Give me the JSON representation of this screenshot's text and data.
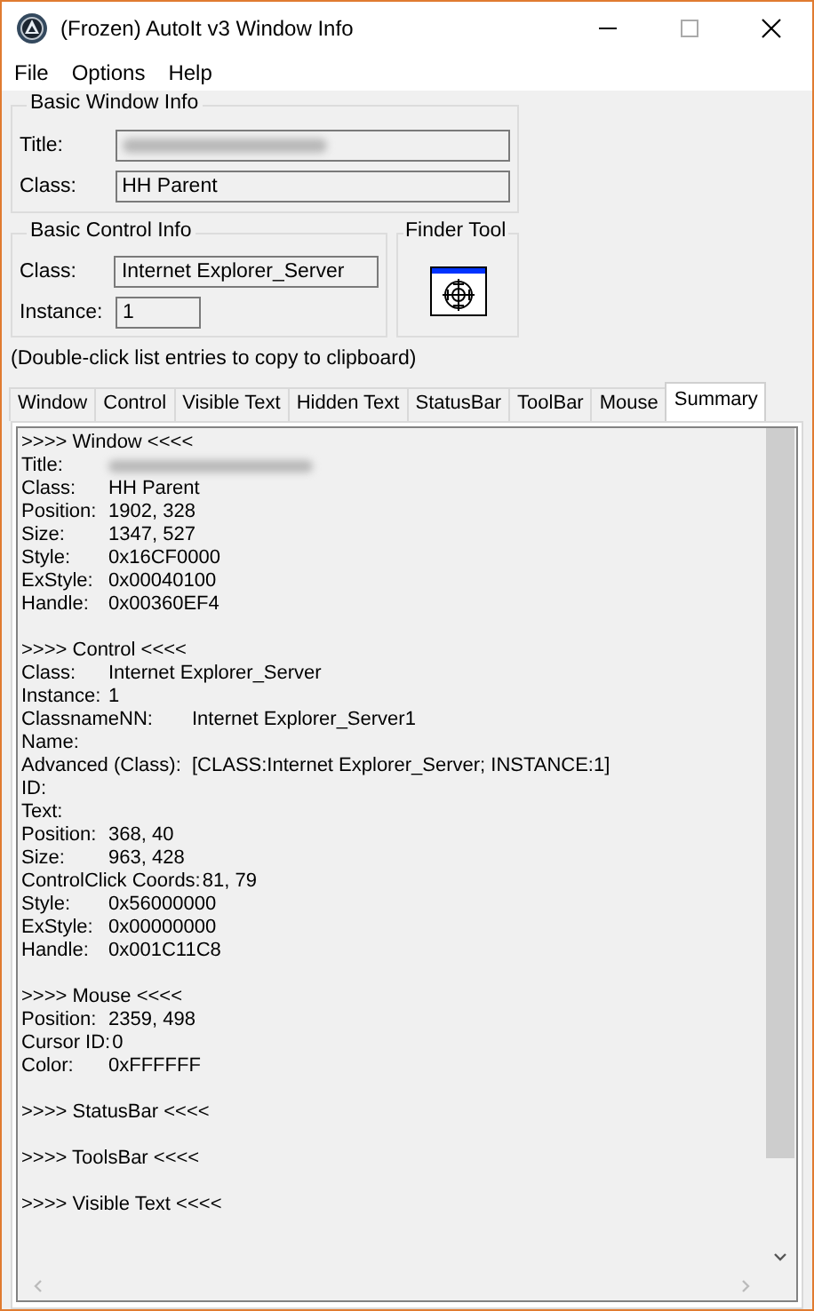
{
  "window": {
    "title": "(Frozen) AutoIt v3 Window Info"
  },
  "menu": [
    "File",
    "Options",
    "Help"
  ],
  "basic_window_info": {
    "title": "Basic Window Info",
    "fields": [
      {
        "label": "Title:",
        "blurred": true
      },
      {
        "label": "Class:",
        "value": "HH Parent",
        "blurred": false
      }
    ]
  },
  "basic_control_info": {
    "title": "Basic Control Info",
    "fields": [
      {
        "label": "Class:",
        "value": "Internet Explorer_Server"
      },
      {
        "label": "Instance:",
        "value": "1"
      }
    ]
  },
  "finder_tool": {
    "title": "Finder Tool"
  },
  "hint": "(Double-click list entries to copy to clipboard)",
  "tabs": [
    {
      "label": "Window",
      "selected": false
    },
    {
      "label": "Control",
      "selected": false
    },
    {
      "label": "Visible Text",
      "selected": false
    },
    {
      "label": "Hidden Text",
      "selected": false
    },
    {
      "label": "StatusBar",
      "selected": false
    },
    {
      "label": "ToolBar",
      "selected": false
    },
    {
      "label": "Mouse",
      "selected": false
    },
    {
      "label": "Summary",
      "selected": true
    }
  ],
  "summary_lines": [
    {
      "kind": "heading",
      "text": ">>>> Window <<<<"
    },
    {
      "kind": "blurred",
      "label": "Title:"
    },
    {
      "kind": "field",
      "label": "Class:",
      "value": "HH Parent"
    },
    {
      "kind": "field",
      "label": "Position:",
      "value": "1902, 328"
    },
    {
      "kind": "field",
      "label": "Size:",
      "value": "1347, 527"
    },
    {
      "kind": "field",
      "label": "Style:",
      "value": "0x16CF0000"
    },
    {
      "kind": "field",
      "label": "ExStyle:",
      "value": "0x00040100"
    },
    {
      "kind": "field",
      "label": "Handle:",
      "value": "0x00360EF4"
    },
    {
      "kind": "blank"
    },
    {
      "kind": "heading",
      "text": ">>>> Control <<<<"
    },
    {
      "kind": "field",
      "label": "Class:",
      "value": "Internet Explorer_Server"
    },
    {
      "kind": "field",
      "label": "Instance:",
      "value": "1"
    },
    {
      "kind": "wide",
      "label": "ClassnameNN:",
      "value": "Internet Explorer_Server1"
    },
    {
      "kind": "field",
      "label": "Name:"
    },
    {
      "kind": "wide",
      "label": "Advanced (Class):",
      "value": "[CLASS:Internet Explorer_Server; INSTANCE:1]"
    },
    {
      "kind": "field",
      "label": "ID:"
    },
    {
      "kind": "field",
      "label": "Text:"
    },
    {
      "kind": "field",
      "label": "Position:",
      "value": "368, 40"
    },
    {
      "kind": "field",
      "label": "Size:",
      "value": "963, 428"
    },
    {
      "kind": "tight",
      "label": "ControlClick Coords:",
      "value": "81, 79"
    },
    {
      "kind": "field",
      "label": "Style:",
      "value": "0x56000000"
    },
    {
      "kind": "field",
      "label": "ExStyle:",
      "value": "0x00000000"
    },
    {
      "kind": "field",
      "label": "Handle:",
      "value": "0x001C11C8"
    },
    {
      "kind": "blank"
    },
    {
      "kind": "heading",
      "text": ">>>> Mouse <<<<"
    },
    {
      "kind": "field",
      "label": "Position:",
      "value": "2359, 498"
    },
    {
      "kind": "tight",
      "label": "Cursor ID:",
      "value": "0"
    },
    {
      "kind": "field",
      "label": "Color:",
      "value": "0xFFFFFF"
    },
    {
      "kind": "blank"
    },
    {
      "kind": "heading",
      "text": ">>>> StatusBar <<<<"
    },
    {
      "kind": "blank"
    },
    {
      "kind": "heading",
      "text": ">>>> ToolsBar <<<<"
    },
    {
      "kind": "blank"
    },
    {
      "kind": "heading",
      "text": ">>>> Visible Text <<<<"
    }
  ]
}
